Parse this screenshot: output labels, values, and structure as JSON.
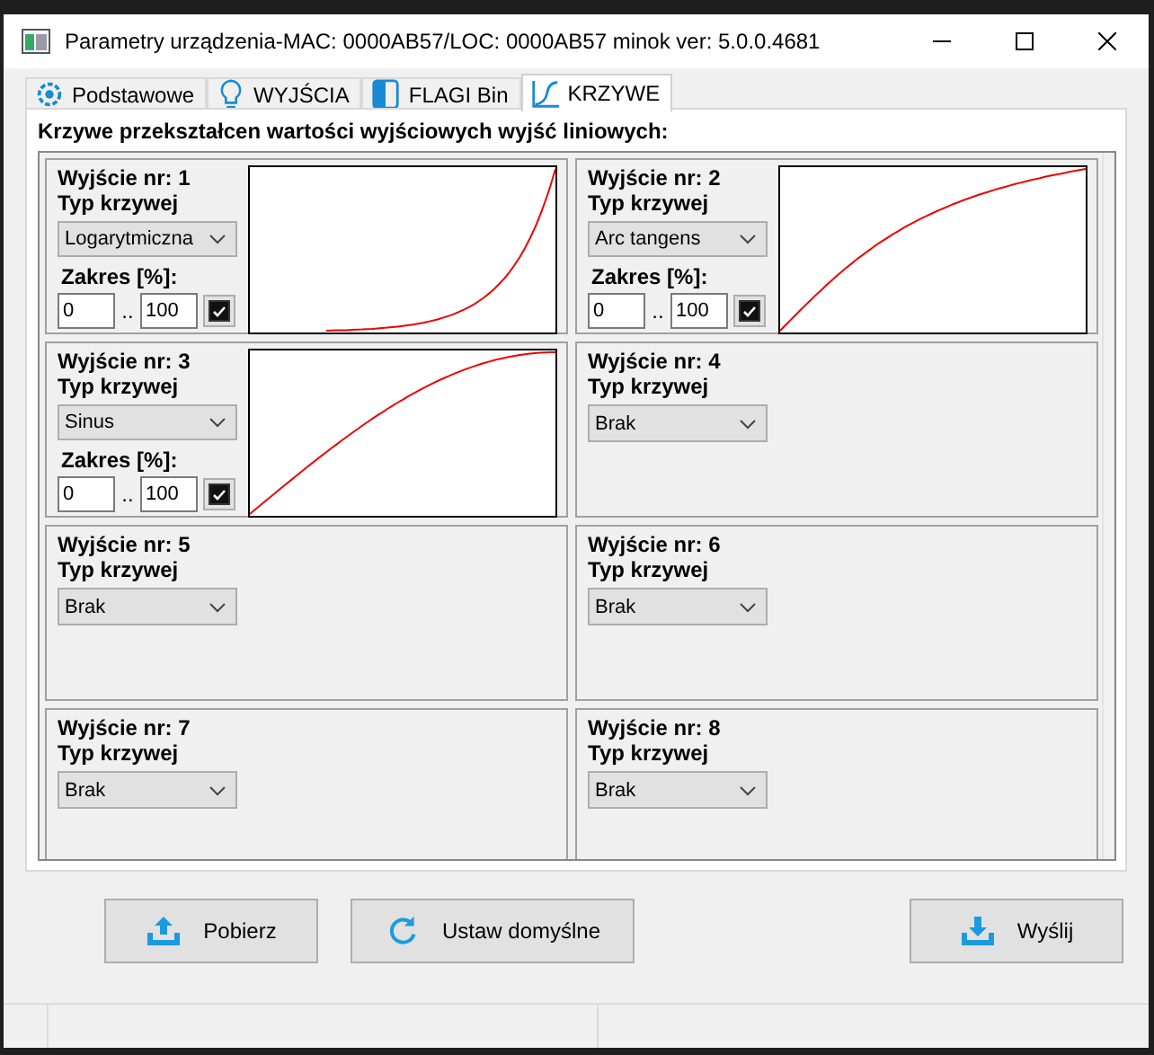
{
  "window": {
    "title": "Parametry urządzenia-MAC: 0000AB57/LOC: 0000AB57 minok ver: 5.0.0.4681"
  },
  "tabs": [
    {
      "label": "Podstawowe",
      "selected": false
    },
    {
      "label": "WYJŚCIA",
      "selected": false
    },
    {
      "label": "FLAGI Bin",
      "selected": false
    },
    {
      "label": "KRZYWE",
      "selected": true
    }
  ],
  "section_title": "Krzywe przekształcen wartości wyjściowych wyjść liniowych:",
  "outputs": [
    {
      "title": "Wyjście nr: 1",
      "type_label": "Typ krzywej",
      "curve": "Logarytmiczna",
      "kind": "logarithmic",
      "range": {
        "label": "Zakres [%]:",
        "from": "0",
        "separator": "..",
        "to": "100",
        "checked": true
      }
    },
    {
      "title": "Wyjście nr: 2",
      "type_label": "Typ krzywej",
      "curve": "Arc tangens",
      "kind": "arctan",
      "range": {
        "label": "Zakres [%]:",
        "from": "0",
        "separator": "..",
        "to": "100",
        "checked": true
      }
    },
    {
      "title": "Wyjście nr: 3",
      "type_label": "Typ krzywej",
      "curve": "Sinus",
      "kind": "sine",
      "range": {
        "label": "Zakres [%]:",
        "from": "0",
        "separator": "..",
        "to": "100",
        "checked": true
      }
    },
    {
      "title": "Wyjście nr: 4",
      "type_label": "Typ krzywej",
      "curve": "Brak",
      "kind": "none"
    },
    {
      "title": "Wyjście nr: 5",
      "type_label": "Typ krzywej",
      "curve": "Brak",
      "kind": "none"
    },
    {
      "title": "Wyjście nr: 6",
      "type_label": "Typ krzywej",
      "curve": "Brak",
      "kind": "none"
    },
    {
      "title": "Wyjście nr: 7",
      "type_label": "Typ krzywej",
      "curve": "Brak",
      "kind": "none"
    },
    {
      "title": "Wyjście nr: 8",
      "type_label": "Typ krzywej",
      "curve": "Brak",
      "kind": "none"
    }
  ],
  "buttons": [
    {
      "label": "Pobierz"
    },
    {
      "label": "Ustaw domyślne"
    },
    {
      "label": "Wyślij"
    }
  ]
}
